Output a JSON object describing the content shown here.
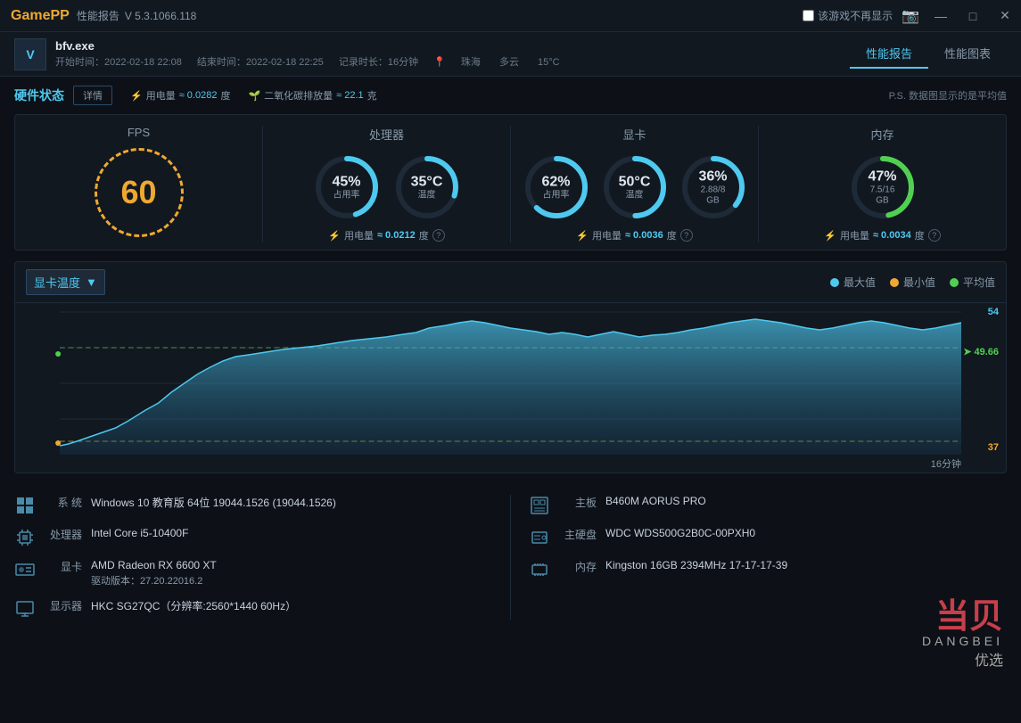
{
  "titlebar": {
    "logo_game": "Game",
    "logo_pp": "PP",
    "report_title": "性能报告",
    "version": "V 5.3.1066.118",
    "no_show_label": "该游戏不再显示",
    "minimize_btn": "—",
    "restore_btn": "□",
    "close_btn": "✕"
  },
  "header": {
    "game_icon": "V",
    "game_name": "bfv.exe",
    "start_time": "开始时间：2022-02-18 22:08",
    "end_time": "结束时间：2022-02-18 22:25",
    "record_time": "记录时长：16分钟",
    "location": "珠海",
    "weather": "多云",
    "temperature": "15°C",
    "tab1": "性能报告",
    "tab2": "性能图表"
  },
  "hw_status": {
    "label": "硬件状态",
    "detail_btn": "详情",
    "power_label": "用电量",
    "power_value": "≈ 0.0282",
    "power_unit": "度",
    "co2_label": "二氧化碳排放量",
    "co2_value": "≈ 22.1",
    "co2_unit": "克",
    "ps_note": "P.S. 数据图显示的是平均值"
  },
  "fps": {
    "label": "FPS",
    "value": "60"
  },
  "cpu": {
    "label": "处理器",
    "usage_percent": "45%",
    "usage_label": "占用率",
    "temp_value": "35°C",
    "temp_label": "温度",
    "power_label": "用电量",
    "power_value": "≈ 0.0212",
    "power_unit": "度",
    "cpu_gauge1_color": "#4ec9f0",
    "cpu_gauge2_color": "#4ec9f0"
  },
  "gpu": {
    "label": "显卡",
    "usage_percent": "62%",
    "usage_label": "占用率",
    "temp_value": "50°C",
    "temp_label": "温度",
    "vram_percent": "36%",
    "vram_label": "2.88/8 GB",
    "power_label": "用电量",
    "power_value": "≈ 0.0036",
    "power_unit": "度"
  },
  "memory": {
    "label": "内存",
    "usage_percent": "47%",
    "usage_label": "7.5/16 GB",
    "power_label": "用电量",
    "power_value": "≈ 0.0034",
    "power_unit": "度"
  },
  "chart": {
    "selector_label": "显卡温度",
    "legend_max": "最大值",
    "legend_min": "最小值",
    "legend_avg": "平均值",
    "max_color": "#4ec9f0",
    "min_color": "#f0a830",
    "avg_color": "#50d050",
    "value_max": "54",
    "value_avg": "49.66",
    "value_min": "37",
    "time_label": "16分钟"
  },
  "sysinfo": {
    "os_key": "系 统",
    "os_val": "Windows 10 教育版 64位   19044.1526 (19044.1526)",
    "cpu_key": "处理器",
    "cpu_val": "Intel Core i5-10400F",
    "gpu_key": "显卡",
    "gpu_val": "AMD Radeon RX 6600 XT",
    "gpu_driver": "驱动版本：27.20.22016.2",
    "monitor_key": "显示器",
    "monitor_val": "HKC SG27QC（分辨率:2560*1440 60Hz）",
    "motherboard_key": "主板",
    "motherboard_val": "B460M AORUS PRO",
    "storage_key": "主硬盘",
    "storage_val": "WDC WDS500G2B0C-00PXH0",
    "ram_key": "内存",
    "ram_val": "Kingston 16GB 2394MHz 17-17-17-39"
  },
  "watermark": {
    "line1": "当贝",
    "line2": "DANGBEI",
    "line3": "优选"
  }
}
